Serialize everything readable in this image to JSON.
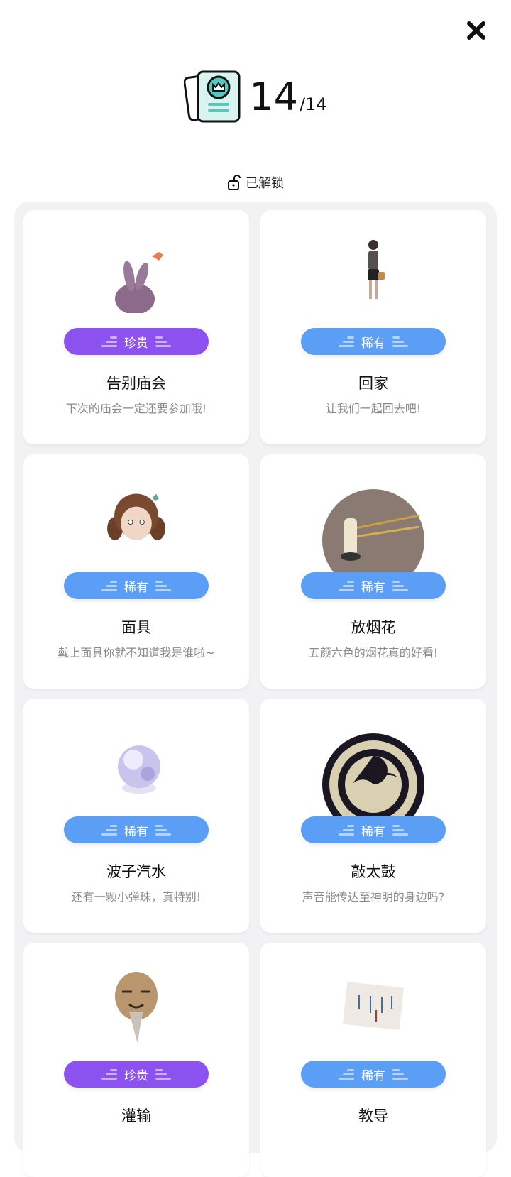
{
  "header": {
    "collected": "14",
    "total": "/14",
    "icon": "collection-card-icon"
  },
  "close": {
    "icon": "close-icon"
  },
  "filter": {
    "label": "已解锁",
    "icon": "unlock-icon"
  },
  "colors": {
    "epic": "#8c52f0",
    "rare": "#5b9ef5",
    "panel_bg": "#f2f2f4"
  },
  "items": [
    {
      "title": "告别庙会",
      "desc": "下次的庙会一定还要参加哦!",
      "rarity": "珍贵",
      "rarity_type": "epic",
      "icon": "rabbit-plush-icon"
    },
    {
      "title": "回家",
      "desc": "让我们一起回去吧!",
      "rarity": "稀有",
      "rarity_type": "rare",
      "icon": "walking-person-icon"
    },
    {
      "title": "面具",
      "desc": "戴上面具你就不知道我是谁啦~",
      "rarity": "稀有",
      "rarity_type": "rare",
      "icon": "girl-mask-icon"
    },
    {
      "title": "放烟花",
      "desc": "五颜六色的烟花真的好看!",
      "rarity": "稀有",
      "rarity_type": "rare",
      "icon": "fireworks-candle-icon"
    },
    {
      "title": "波子汽水",
      "desc": "还有一颗小弹珠，真特别!",
      "rarity": "稀有",
      "rarity_type": "rare",
      "icon": "marble-icon"
    },
    {
      "title": "敲太鼓",
      "desc": "声音能传达至神明的身边吗?",
      "rarity": "稀有",
      "rarity_type": "rare",
      "icon": "taiko-drum-icon"
    },
    {
      "title": "灌输",
      "desc": "",
      "rarity": "珍贵",
      "rarity_type": "epic",
      "icon": "noh-mask-icon"
    },
    {
      "title": "教导",
      "desc": "",
      "rarity": "稀有",
      "rarity_type": "rare",
      "icon": "calligraphy-paper-icon"
    }
  ]
}
